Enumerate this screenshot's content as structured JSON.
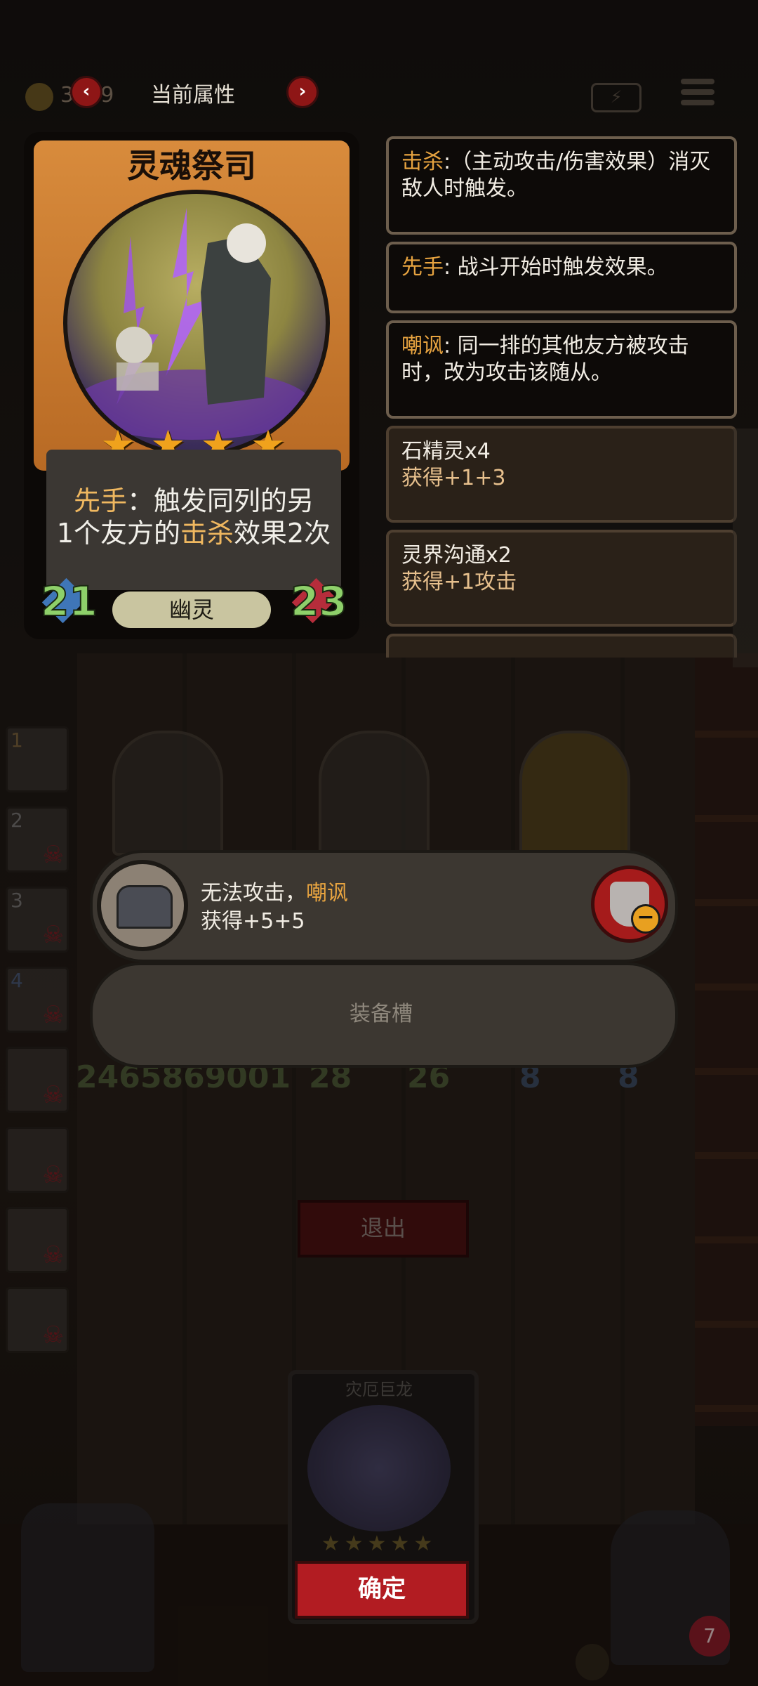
{
  "header": {
    "coins": "3619",
    "title": "当前属性",
    "prev_arrow": "‹",
    "next_arrow": "›"
  },
  "card": {
    "name": "灵魂祭司",
    "stars": 4,
    "desc_line1_pre": "",
    "desc_keyword1": "先手",
    "desc_line1_rest": "：触发同列的另",
    "desc_line2_pre": "1个友方的",
    "desc_keyword2": "击杀",
    "desc_line2_rest": "效果2次",
    "attack": "21",
    "health": "23",
    "type": "幽灵"
  },
  "keywords": [
    {
      "name": "击杀",
      "text": ":（主动攻击/伤害效果）消灭敌人时触发。"
    },
    {
      "name": "先手",
      "text": ": 战斗开始时触发效果。"
    },
    {
      "name": "嘲讽",
      "text": ": 同一排的其他友方被攻击时，改为攻击该随从。"
    }
  ],
  "buffs": [
    {
      "name": "石精灵x4",
      "gain": "获得+1+3"
    },
    {
      "name": "灵界沟通x2",
      "gain": "获得+1攻击"
    }
  ],
  "side_tiles": [
    "1",
    "2",
    "3",
    "4",
    "",
    "",
    "",
    ""
  ],
  "equipment": {
    "line1_pre": "无法攻击，",
    "line1_keyword": "嘲讽",
    "line2": "获得+5+5",
    "slot_label": "装备槽"
  },
  "board_stats": {
    "left": "2465869001",
    "mid_a": "28",
    "mid_b": "26",
    "right_a": "8",
    "right_b": "8"
  },
  "exit_label": "退出",
  "bottom_card": {
    "name": "灾厄巨龙",
    "stars": "★★★★★",
    "confirm_label": "确定"
  },
  "lives": "7",
  "colors": {
    "accent_red": "#b21c22",
    "keyword_gold": "#e8a440",
    "stat_green": "#8ed06a",
    "card_orange": "#d88b3c"
  }
}
